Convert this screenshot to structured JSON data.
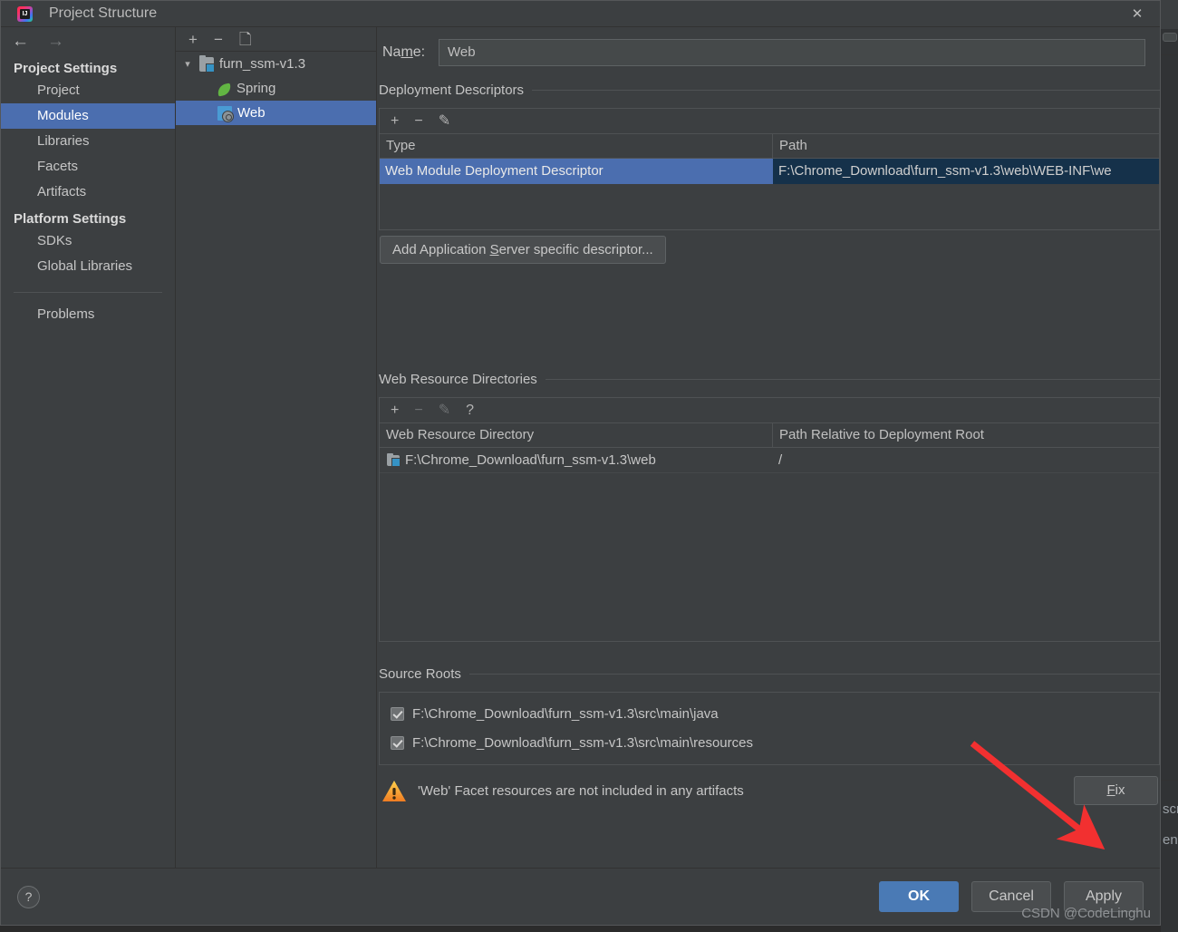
{
  "window": {
    "title": "Project Structure",
    "logo_text": "IJ",
    "logo_icon": "intellij-idea-logo",
    "close_icon": "close-icon"
  },
  "sidebar": {
    "back_icon": "back-arrow-icon",
    "forward_icon": "forward-arrow-icon",
    "groups": [
      {
        "heading": "Project Settings",
        "items": [
          {
            "label": "Project",
            "selected": false
          },
          {
            "label": "Modules",
            "selected": true
          },
          {
            "label": "Libraries",
            "selected": false
          },
          {
            "label": "Facets",
            "selected": false
          },
          {
            "label": "Artifacts",
            "selected": false
          }
        ]
      },
      {
        "heading": "Platform Settings",
        "items": [
          {
            "label": "SDKs",
            "selected": false
          },
          {
            "label": "Global Libraries",
            "selected": false
          }
        ]
      }
    ],
    "problems_label": "Problems"
  },
  "tree": {
    "toolbar": {
      "add_icon": "plus-icon",
      "remove_icon": "minus-icon",
      "copy_icon": "copy-icon"
    },
    "nodes": [
      {
        "label": "furn_ssm-v1.3",
        "icon": "module-folder-icon",
        "selected": false,
        "expanded": true
      },
      {
        "label": "Spring",
        "icon": "spring-leaf-icon",
        "selected": false
      },
      {
        "label": "Web",
        "icon": "web-facet-icon",
        "selected": true
      }
    ]
  },
  "main": {
    "name_label_pre": "Na",
    "name_label_mn": "m",
    "name_label_post": "e:",
    "name_value": "Web",
    "deployment": {
      "group_label": "Deployment Descriptors",
      "toolbar": {
        "add_icon": "plus-icon",
        "remove_icon": "minus-icon",
        "edit_icon": "pencil-icon"
      },
      "columns": [
        "Type",
        "Path"
      ],
      "rows": [
        {
          "type": "Web Module Deployment Descriptor",
          "path": "F:\\Chrome_Download\\furn_ssm-v1.3\\web\\WEB-INF\\we",
          "selected": true
        }
      ],
      "add_button_pre": "Add Application ",
      "add_button_mn": "S",
      "add_button_post": "erver specific descriptor..."
    },
    "web_resources": {
      "group_label": "Web Resource Directories",
      "toolbar": {
        "add_icon": "plus-icon",
        "remove_icon": "minus-icon",
        "edit_icon": "pencil-icon",
        "help_icon": "question-mark-icon"
      },
      "columns": [
        "Web Resource Directory",
        "Path Relative to Deployment Root"
      ],
      "rows": [
        {
          "directory": "F:\\Chrome_Download\\furn_ssm-v1.3\\web",
          "relative_path": "/",
          "icon": "web-dir-folder-icon"
        }
      ]
    },
    "source_roots": {
      "group_label": "Source Roots",
      "items": [
        {
          "label": "F:\\Chrome_Download\\furn_ssm-v1.3\\src\\main\\java",
          "checked": true
        },
        {
          "label": "F:\\Chrome_Download\\furn_ssm-v1.3\\src\\main\\resources",
          "checked": true
        }
      ]
    },
    "warning": {
      "icon": "warning-triangle-icon",
      "text": "'Web' Facet resources are not included in any artifacts",
      "fix_pre": "F",
      "fix_mn": "i",
      "fix_post": "x"
    }
  },
  "footer": {
    "help_icon": "question-mark-icon",
    "help_label": "?",
    "buttons": [
      {
        "label": "OK",
        "style": "primary"
      },
      {
        "label": "Cancel",
        "style": "normal"
      },
      {
        "label": "Apply",
        "style": "normal"
      }
    ]
  },
  "watermark": "CSDN @CodeLinghu",
  "annotation": {
    "arrow_icon": "red-pointer-arrow",
    "color": "#f23030"
  },
  "background": {
    "fragment_1": "scr",
    "fragment_2": "en"
  },
  "colors": {
    "selection_blue": "#4b6eaf",
    "cell_focus_navy": "#15314a",
    "panel_bg": "#3c3f41",
    "spring_green": "#62b543",
    "web_blue": "#4a9bd4",
    "warning_orange": "#f5a623",
    "primary_button": "#4a7ab5",
    "annotation_red": "#f23030"
  }
}
